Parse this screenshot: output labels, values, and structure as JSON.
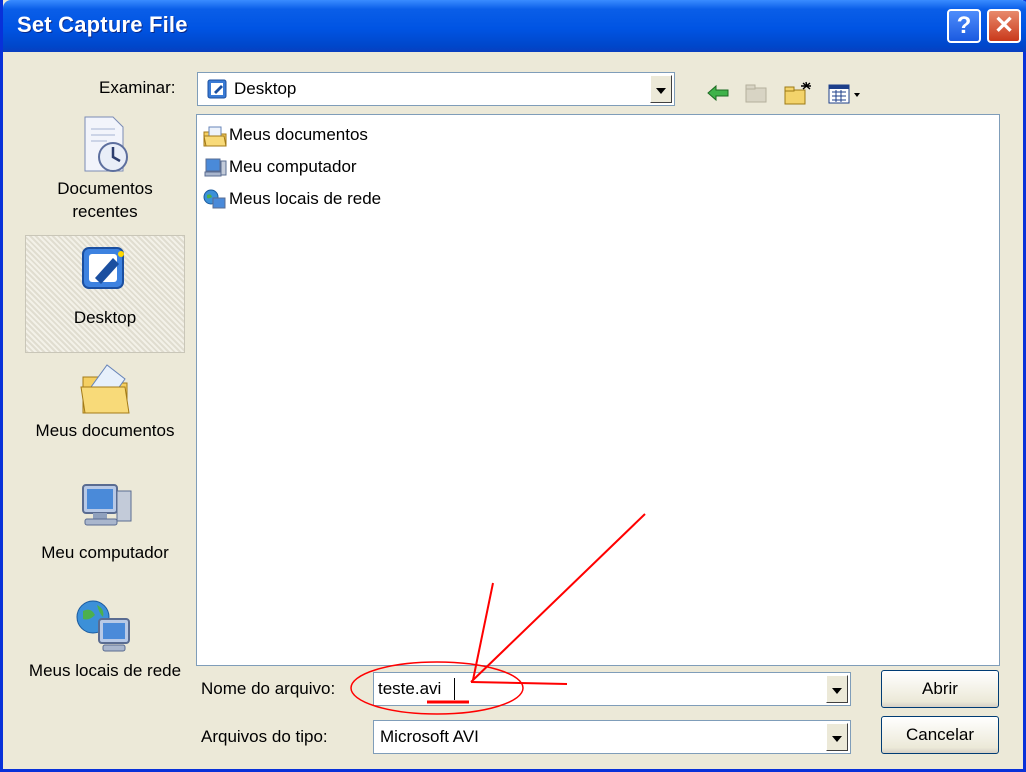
{
  "window": {
    "title": "Set Capture File",
    "help_label": "?",
    "close_label": "✕"
  },
  "look_in": {
    "label": "Examinar:",
    "value": "Desktop"
  },
  "toolbar": {
    "back_icon": "back-arrow-icon",
    "up_icon": "up-folder-icon",
    "new_folder_icon": "new-folder-icon",
    "view_icon": "view-menu-icon"
  },
  "places": [
    {
      "label": "Documentos recentes",
      "icon": "recent-documents-icon"
    },
    {
      "label": "Desktop",
      "icon": "desktop-icon"
    },
    {
      "label": "Meus documentos",
      "icon": "my-documents-icon"
    },
    {
      "label": "Meu computador",
      "icon": "my-computer-icon"
    },
    {
      "label": "Meus locais de rede",
      "icon": "network-places-icon"
    }
  ],
  "files": [
    {
      "name": "Meus documentos",
      "icon": "folder-documents-icon"
    },
    {
      "name": "Meu computador",
      "icon": "computer-icon"
    },
    {
      "name": "Meus locais de rede",
      "icon": "network-icon"
    }
  ],
  "filename": {
    "label": "Nome do arquivo:",
    "value": "teste.avi"
  },
  "filetype": {
    "label": "Arquivos do tipo:",
    "value": "Microsoft AVI"
  },
  "buttons": {
    "open": "Abrir",
    "cancel": "Cancelar"
  },
  "colors": {
    "title_bar": "#0054e3",
    "dialog_bg": "#ece9d8",
    "annotation": "#ff0000"
  }
}
